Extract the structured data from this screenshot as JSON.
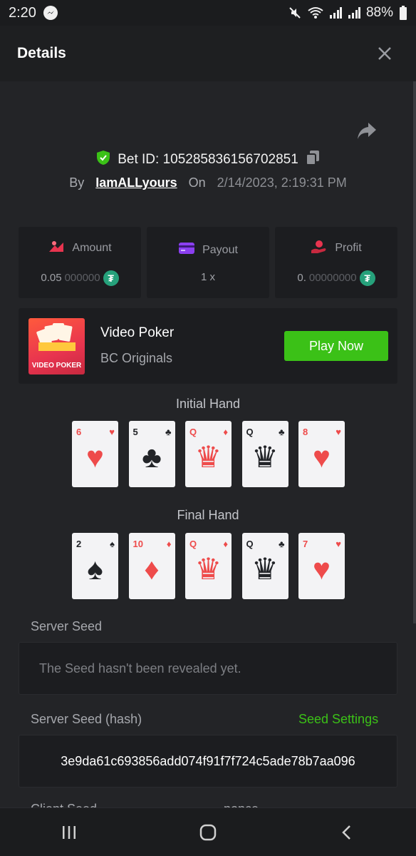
{
  "status_bar": {
    "time": "2:20",
    "battery": "88%"
  },
  "header": {
    "title": "Details"
  },
  "bet": {
    "id_label": "Bet ID: 105285836156702851",
    "by_label": "By",
    "user": "IamALLyours",
    "on_label": "On",
    "date": "2/14/2023, 2:19:31 PM"
  },
  "stats": {
    "amount": {
      "label": "Amount",
      "value_main": "0.05",
      "value_dim": "000000"
    },
    "payout": {
      "label": "Payout",
      "value": "1 x"
    },
    "profit": {
      "label": "Profit",
      "value_main": "0.",
      "value_dim": "00000000"
    }
  },
  "game": {
    "thumb_label": "VIDEO POKER",
    "name": "Video Poker",
    "provider": "BC Originals",
    "play_label": "Play Now"
  },
  "initial_hand": {
    "title": "Initial Hand",
    "cards": [
      {
        "rank": "6",
        "suit": "♥",
        "color": "#ee4b4b"
      },
      {
        "rank": "5",
        "suit": "♣",
        "color": "#222428"
      },
      {
        "rank": "Q",
        "suit": "♦",
        "color": "#ee4b4b"
      },
      {
        "rank": "Q",
        "suit": "♣",
        "color": "#222428"
      },
      {
        "rank": "8",
        "suit": "♥",
        "color": "#ee4b4b"
      }
    ]
  },
  "final_hand": {
    "title": "Final Hand",
    "cards": [
      {
        "rank": "2",
        "suit": "♠",
        "color": "#222428"
      },
      {
        "rank": "10",
        "suit": "♦",
        "color": "#ee4b4b"
      },
      {
        "rank": "Q",
        "suit": "♦",
        "color": "#ee4b4b"
      },
      {
        "rank": "Q",
        "suit": "♣",
        "color": "#222428"
      },
      {
        "rank": "7",
        "suit": "♥",
        "color": "#ee4b4b"
      }
    ]
  },
  "seeds": {
    "server_seed_label": "Server Seed",
    "server_seed_value": "The Seed hasn't been revealed yet.",
    "server_hash_label": "Server Seed (hash)",
    "seed_settings_label": "Seed Settings",
    "server_hash_value": "3e9da61c693856add074f91f7f724c5ade78b7aa096",
    "client_seed_label": "Client Seed",
    "nonce_label": "nonce"
  },
  "colors": {
    "accent_green": "#3bc117",
    "background": "#232427",
    "panel": "#1c1d20"
  }
}
